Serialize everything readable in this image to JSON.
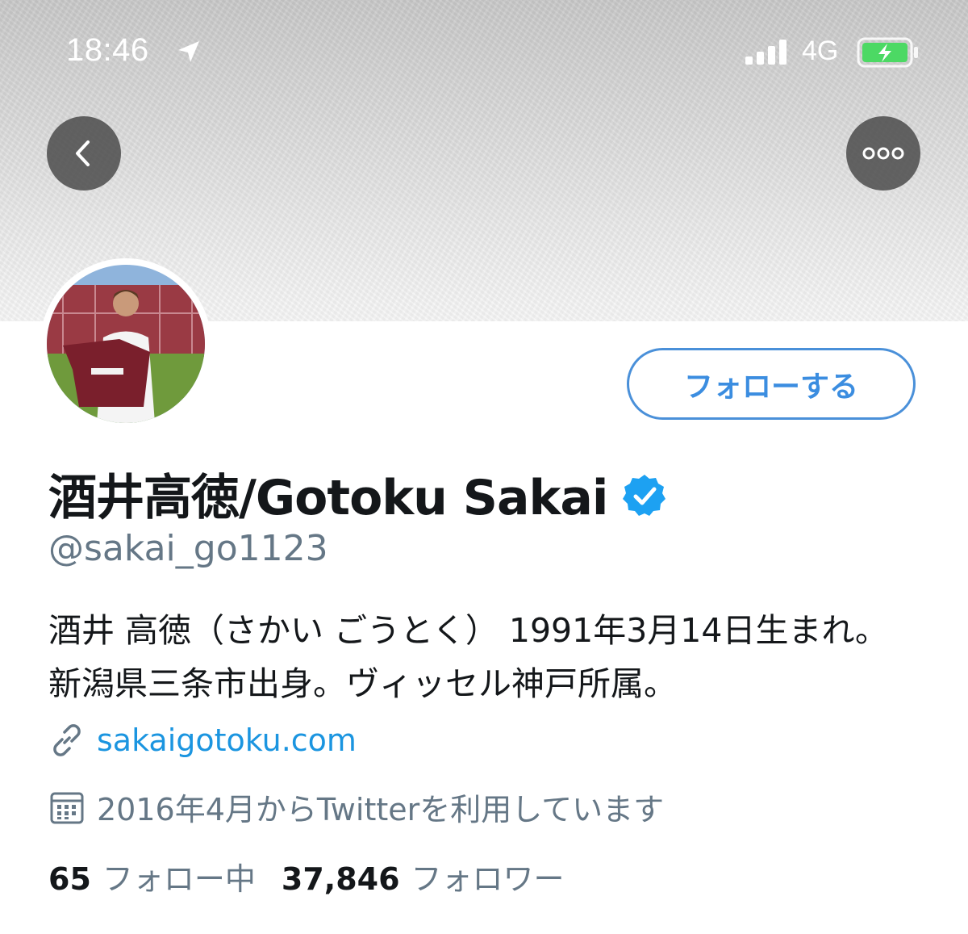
{
  "status_bar": {
    "time": "18:46",
    "network": "4G",
    "location_icon": "location-arrow-icon",
    "signal_icon": "signal-bars-icon",
    "battery_icon": "battery-charging-icon",
    "battery_color": "#4cd964"
  },
  "nav": {
    "back_icon": "chevron-left-icon",
    "more_icon": "more-dots-icon"
  },
  "profile": {
    "avatar_icon": "avatar",
    "follow_button": "フォローする",
    "display_name": "酒井高徳/Gotoku Sakai",
    "verified_icon": "verified-badge-icon",
    "handle": "@sakai_go1123",
    "bio": "酒井 高徳（さかい ごうとく） 1991年3月14日生まれ。 新潟県三条市出身。ヴィッセル神戸所属。",
    "url_icon": "link-icon",
    "url": "sakaigotoku.com",
    "joined_icon": "calendar-icon",
    "joined": "2016年4月からTwitterを利用しています",
    "following_count": "65",
    "following_label": "フォロー中",
    "followers_count": "37,846",
    "followers_label": "フォロワー"
  },
  "colors": {
    "accent": "#1b95e0",
    "secondary_text": "#657786",
    "follow_border": "#4a90d9"
  }
}
